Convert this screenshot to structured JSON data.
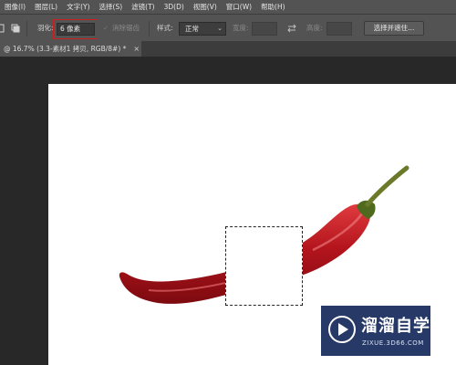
{
  "menubar": {
    "items": [
      "图像(I)",
      "图层(L)",
      "文字(Y)",
      "选择(S)",
      "滤镜(T)",
      "3D(D)",
      "视图(V)",
      "窗口(W)",
      "帮助(H)"
    ]
  },
  "options": {
    "feather_label": "羽化:",
    "feather_value": "6 像素",
    "antialias_label": "消除锯齿",
    "style_label": "样式:",
    "style_value": "正常",
    "width_label": "宽度:",
    "height_label": "高度:",
    "select_mask_button": "选择并遮住..."
  },
  "document": {
    "tab_label": "@ 16.7% (3.3-素材1 拷贝, RGB/8#) *",
    "close_glyph": "×"
  },
  "watermark": {
    "title": "溜溜自学",
    "url": "ZIXUE.3D66.COM"
  },
  "colors": {
    "highlight": "#c81e1e",
    "chili_red": "#b3141c",
    "stem_green": "#6b7a2a"
  }
}
